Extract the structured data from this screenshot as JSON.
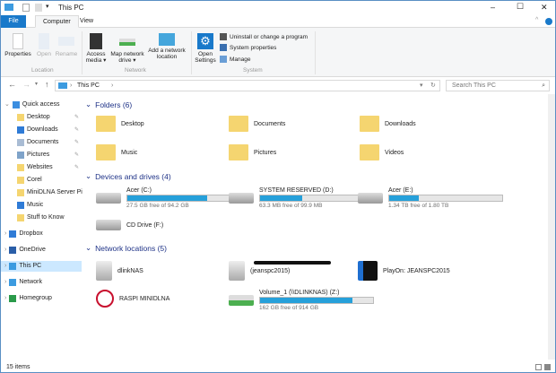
{
  "window": {
    "title": "This PC",
    "minimize": "–",
    "maximize": "☐",
    "close": "✕"
  },
  "ribbon": {
    "tabs": [
      "File",
      "Computer",
      "View"
    ],
    "location": {
      "label": "Location",
      "properties": "Properties",
      "open": "Open",
      "rename": "Rename"
    },
    "network": {
      "label": "Network",
      "access_media": "Access media ▾",
      "map_drive": "Map network drive ▾",
      "add_location": "Add a network location"
    },
    "system": {
      "label": "System",
      "open_settings": "Open Settings",
      "uninstall": "Uninstall or change a program",
      "system_properties": "System properties",
      "manage": "Manage"
    }
  },
  "address": {
    "path": "This PC",
    "search_placeholder": "Search This PC"
  },
  "nav": {
    "items": [
      {
        "label": "Quick access",
        "icon": "star-icon",
        "color": "#3c8ee0"
      },
      {
        "label": "Desktop",
        "icon": "folder-icon",
        "color": "#f5d570",
        "pinned": true
      },
      {
        "label": "Downloads",
        "icon": "download-icon",
        "color": "#2f7bd6",
        "pinned": true
      },
      {
        "label": "Documents",
        "icon": "document-icon",
        "color": "#a9bcd4",
        "pinned": true
      },
      {
        "label": "Pictures",
        "icon": "picture-icon",
        "color": "#7fa3c9",
        "pinned": true
      },
      {
        "label": "Websites",
        "icon": "folder-icon",
        "color": "#f5d570",
        "pinned": true
      },
      {
        "label": "Corel",
        "icon": "folder-icon",
        "color": "#f5d570"
      },
      {
        "label": "MiniDLNA Server Pi",
        "icon": "folder-icon",
        "color": "#f5d570"
      },
      {
        "label": "Music",
        "icon": "music-icon",
        "color": "#2f7bd6"
      },
      {
        "label": "Stuff to Know",
        "icon": "folder-icon",
        "color": "#f5d570"
      },
      {
        "label": "Dropbox",
        "icon": "dropbox-icon",
        "color": "#2f7bd6"
      },
      {
        "label": "OneDrive",
        "icon": "cloud-icon",
        "color": "#2a5ea8"
      },
      {
        "label": "This PC",
        "icon": "computer-icon",
        "color": "#3c9be0",
        "selected": true
      },
      {
        "label": "Network",
        "icon": "network-icon",
        "color": "#3c9be0"
      },
      {
        "label": "Homegroup",
        "icon": "homegroup-icon",
        "color": "#2a9a4a"
      }
    ]
  },
  "folders": {
    "header": "Folders (6)",
    "items": [
      "Desktop",
      "Documents",
      "Downloads",
      "Music",
      "Pictures",
      "Videos"
    ]
  },
  "drives": {
    "header": "Devices and drives (4)",
    "items": [
      {
        "name": "Acer (C:)",
        "space": "27.5 GB free of 94.2 GB",
        "used_pct": 71
      },
      {
        "name": "SYSTEM RESERVED (D:)",
        "space": "63.3 MB free of 99.9 MB",
        "used_pct": 37
      },
      {
        "name": "Acer (E:)",
        "space": "1.34 TB free of 1.80 TB",
        "used_pct": 26
      },
      {
        "name": "CD Drive (F:)"
      }
    ]
  },
  "network": {
    "header": "Network locations (5)",
    "items": [
      {
        "name": "dlinkNAS"
      },
      {
        "name": "(jeanspc2015)"
      },
      {
        "name": "PlayOn: JEANSPC2015"
      },
      {
        "name": "RASPI MINIDLNA"
      },
      {
        "name": "Volume_1 (\\\\DLINKNAS) (Z:)",
        "space": "162 GB free of 914 GB",
        "used_pct": 82
      }
    ]
  },
  "status": {
    "count": "15 items"
  },
  "colors": {
    "accent": "#1979ca",
    "bar": "#26a0da",
    "header": "#1e3287",
    "selection": "#cce8ff"
  }
}
